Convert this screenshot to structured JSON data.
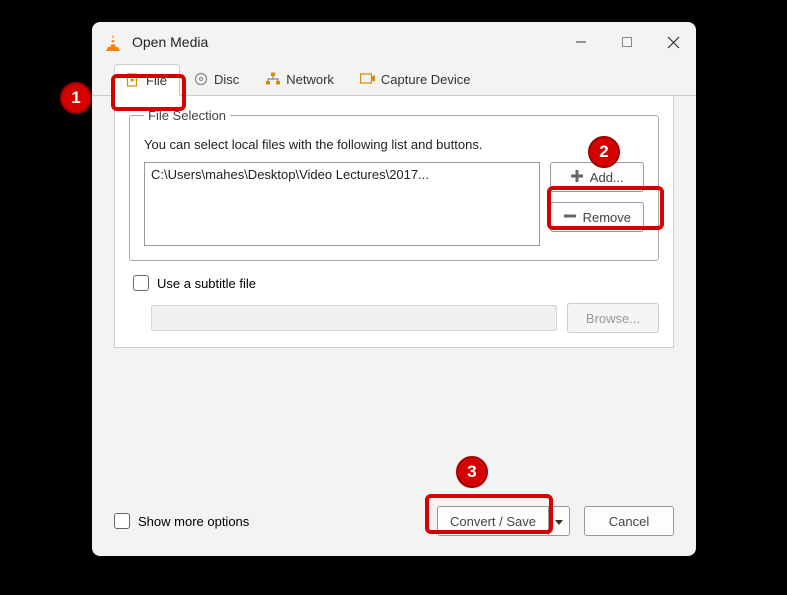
{
  "window": {
    "title": "Open Media"
  },
  "tabs": {
    "file": "File",
    "disc": "Disc",
    "network": "Network",
    "capture": "Capture Device"
  },
  "file_selection": {
    "legend": "File Selection",
    "help": "You can select local files with the following list and buttons.",
    "selected_file": "C:\\Users\\mahes\\Desktop\\Video Lectures\\2017...",
    "add_label": "Add...",
    "remove_label": "Remove"
  },
  "subtitle": {
    "checkbox_label": "Use a subtitle file",
    "browse_label": "Browse..."
  },
  "bottom": {
    "show_more": "Show more options",
    "convert_save": "Convert / Save",
    "cancel": "Cancel"
  },
  "annotations": {
    "n1": "1",
    "n2": "2",
    "n3": "3"
  }
}
